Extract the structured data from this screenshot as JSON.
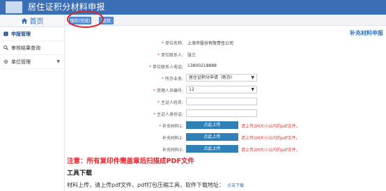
{
  "header": {
    "title": "居住证积分材料申报",
    "bg_color": "#3b6fb5"
  },
  "sidebar": {
    "home": "首页",
    "items": [
      {
        "label": "申报管理",
        "icon": "book-icon",
        "active": true
      },
      {
        "label": "审核结果查询",
        "icon": "search-icon"
      },
      {
        "label": "单位管理",
        "icon": "gear-icon",
        "caret": "▼"
      }
    ]
  },
  "toolbar": {
    "save_label": "保存(完成)",
    "back_label": "返回"
  },
  "form": {
    "section_title": "补充材料申报",
    "fields": [
      {
        "label": "单位名称:",
        "value": "上海市股份有限责任公司"
      },
      {
        "label": "单位联系人:",
        "value": "张三"
      },
      {
        "label": "单位联系人电话:",
        "value": "13800218888"
      },
      {
        "label": "所办业务:",
        "value": "居住证积分申请（新办）",
        "arrow": "▼"
      },
      {
        "label": "受理人员编号:",
        "value": "12",
        "arrow": "▼"
      },
      {
        "label": "主证人姓名:",
        "value": ""
      },
      {
        "label": "主证人身份证:",
        "value": ""
      }
    ],
    "uploads": [
      {
        "label": "补充材料1:",
        "button": "点此上传",
        "note": "请上传2M大小以内的pdf文件。"
      },
      {
        "label": "补充材料2:",
        "button": "点此上传",
        "note": "请上传2M大小以内的pdf文件。"
      },
      {
        "label": "补充材料3:",
        "button": "点此上传",
        "note": "请上传2M大小以内的pdf文件。"
      }
    ]
  },
  "notice": "注意：所有复印件需盖章后扫描成PDF文件",
  "tools": {
    "title": "工具下载",
    "desc": "材料上传，请上传pdf文件，pdf打包压缩工具，软件下载地址：",
    "link": "点击下载"
  },
  "colors": {
    "accent": "#2f6fb8",
    "warning": "#e8262d",
    "upload": "#2f80b6"
  }
}
